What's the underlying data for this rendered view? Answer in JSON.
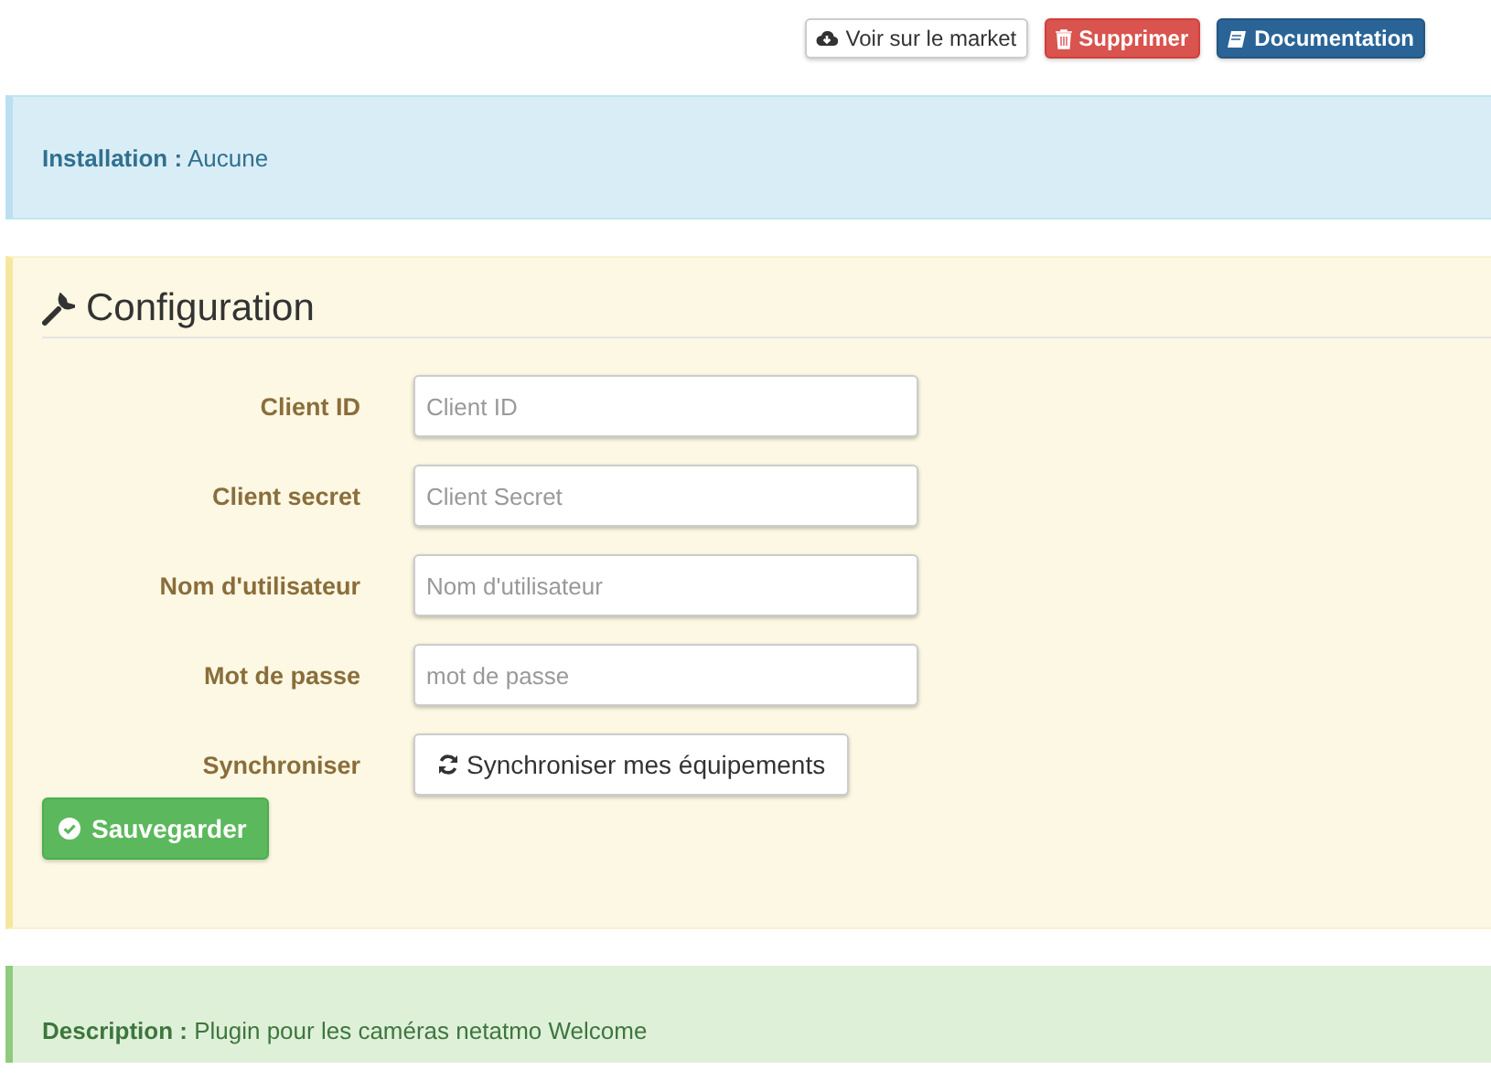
{
  "actions": [
    {
      "kind": "market",
      "label": "Voir sur le market"
    },
    {
      "kind": "delete",
      "label": "Supprimer"
    },
    {
      "kind": "docs",
      "label": "Documentation"
    }
  ],
  "installation": "**Installation :** Aucune",
  "configuration": {
    "title": "Configuration",
    "fields": [
      {
        "kind": "input",
        "label": "Client ID",
        "placeholder": "Client ID"
      },
      {
        "kind": "input",
        "label": "Client secret",
        "placeholder": "Client Secret"
      },
      {
        "kind": "input",
        "label": "Nom d'utilisateur",
        "placeholder": "Nom d'utilisateur"
      },
      {
        "kind": "input",
        "label": "Mot de passe",
        "placeholder": "mot de passe"
      },
      {
        "kind": "button",
        "label": "Synchroniser",
        "button": "Synchroniser mes équipements"
      }
    ],
    "save": "Sauvegarder"
  },
  "description": "**Description :** Plugin pour les caméras netatmo Welcome"
}
